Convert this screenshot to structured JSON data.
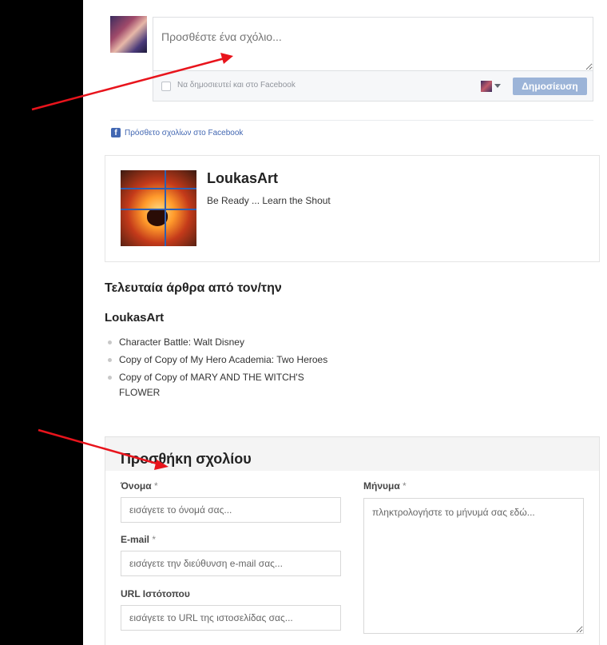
{
  "fb_comments": {
    "placeholder": "Προσθέστε ένα σχόλιο...",
    "also_post_label": "Να δημοσιευτεί και στο Facebook",
    "post_button": "Δημοσίευση",
    "plugin_label": "Πρόσθετο σχολίων στο Facebook"
  },
  "author": {
    "name": "LoukasArt",
    "tagline": "Be Ready ... Learn the Shout"
  },
  "latest": {
    "heading": "Τελευταία άρθρα από τον/την",
    "author_name": "LoukasArt",
    "articles": [
      "Character Battle: Walt Disney",
      "Copy of Copy of My Hero Academia: Two Heroes",
      "Copy of Copy of MARY AND THE WITCH'S FLOWER"
    ]
  },
  "comment_form": {
    "heading": "Προσθήκη σχολίου",
    "name_label": "Όνομα",
    "name_placeholder": "εισάγετε το όνομά σας...",
    "email_label": "E-mail",
    "email_placeholder": "εισάγετε την διεύθυνση e-mail σας...",
    "url_label": "URL Ιστότοπου",
    "url_placeholder": "εισάγετε το URL της ιστοσελίδας σας...",
    "message_label": "Μήνυμα",
    "message_placeholder": "πληκτρολογήστε το μήνυμά σας εδώ...",
    "required_mark": "*"
  },
  "colors": {
    "annotation_arrow": "#e8141c",
    "facebook_blue": "#4267b2",
    "post_button": "#9cb4d8"
  }
}
